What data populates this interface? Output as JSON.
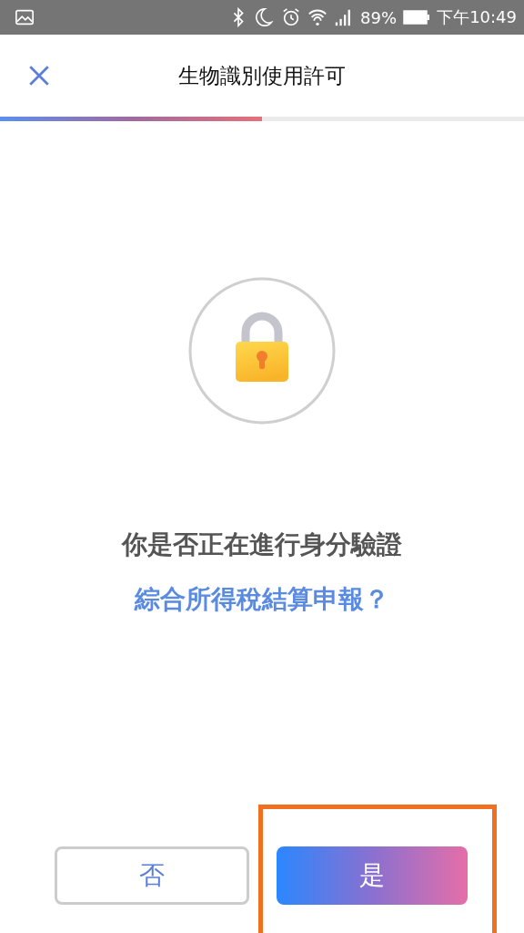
{
  "status_bar": {
    "battery_percent": "89%",
    "time": "下午10:49"
  },
  "header": {
    "title": "生物識別使用許可"
  },
  "progress": {
    "level": 0.5
  },
  "prompt": {
    "question": "你是否正在進行身分驗證",
    "subject": "綜合所得稅結算申報？"
  },
  "buttons": [
    {
      "label": "否",
      "kind": "secondary"
    },
    {
      "label": "是",
      "kind": "primary",
      "highlighted": true
    }
  ]
}
